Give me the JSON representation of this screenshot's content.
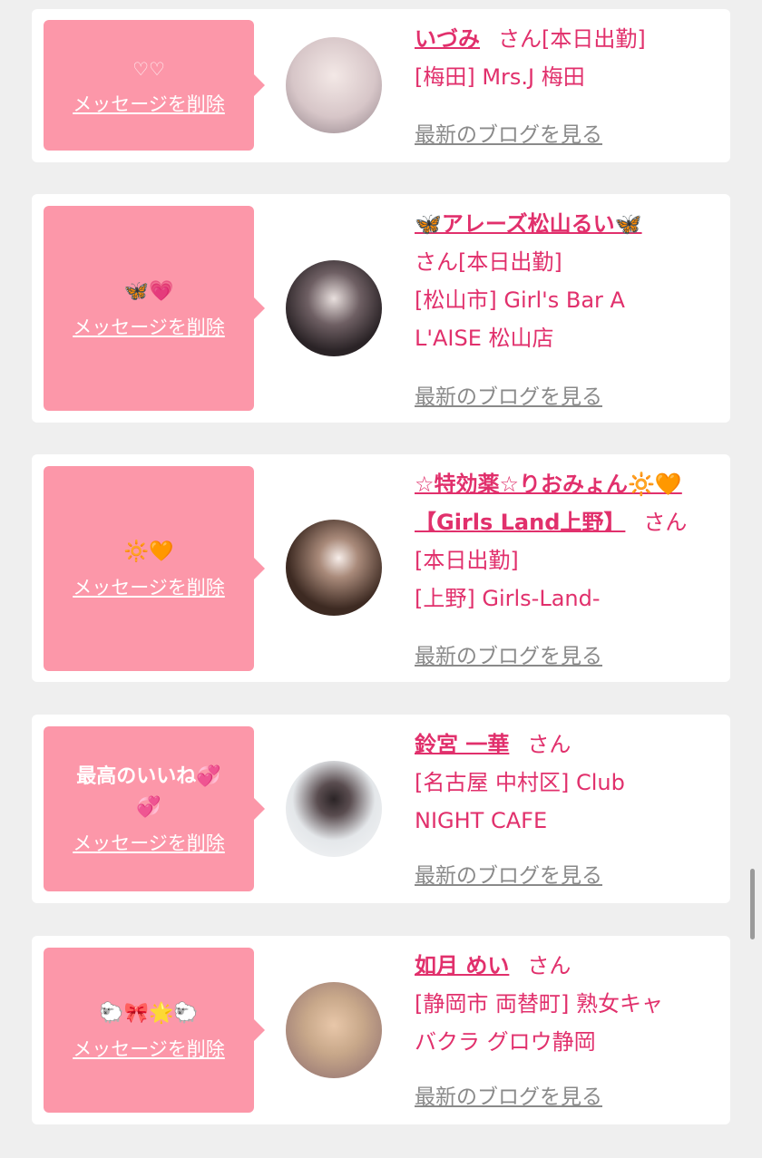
{
  "common": {
    "delete_label": "メッセージを削除",
    "blog_label": "最新のブログを見る",
    "san": "さん"
  },
  "cards": [
    {
      "message": "♡♡",
      "name": "いづみ",
      "line2": "[本日出勤]",
      "line3": "[梅田] Mrs.J 梅田",
      "avatar_color": "#d7c6c8"
    },
    {
      "message": "🦋💗",
      "name": "🦋アレーズ松山るい🦋",
      "line2": "さん[本日出勤]",
      "line3": "[松山市] Girl's Bar A",
      "line4": "L'AISE 松山店",
      "avatar_color": "#3a3236"
    },
    {
      "message": "🔆🧡",
      "name": "☆特効薬☆りおみょん🔆🧡",
      "name2": "【Girls Land上野】",
      "line2": "[本日出勤]",
      "line3": "[上野] Girls-Land-",
      "avatar_color": "#3d2a22"
    },
    {
      "message": "最高のいいね💞",
      "message2": "💞",
      "name": "鈴宮 一華",
      "line2": "[名古屋 中村区] Club",
      "line3": "NIGHT CAFE",
      "avatar_color": "#e4e7ea"
    },
    {
      "message": "🐑🎀🌟🐑",
      "name": "如月 めい",
      "line2": "[静岡市 両替町] 熟女キャ",
      "line3": "バクラ グロウ静岡",
      "avatar_color": "#c8a88a"
    }
  ]
}
